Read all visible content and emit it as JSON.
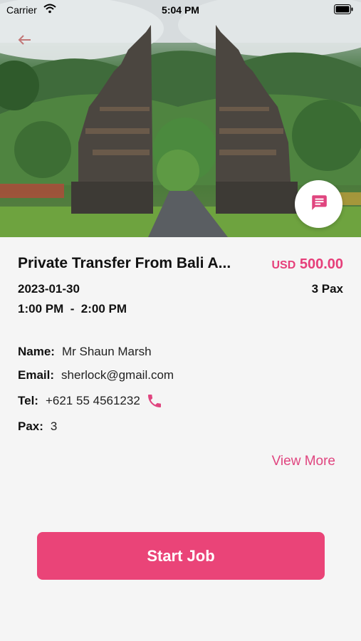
{
  "status_bar": {
    "carrier": "Carrier",
    "time": "5:04 PM"
  },
  "booking": {
    "title": "Private Transfer From Bali A...",
    "price_currency": "USD",
    "price_amount": "500.00",
    "date": "2023-01-30",
    "pax_summary": "3 Pax",
    "time_range": "1:00 PM  -  2:00 PM"
  },
  "customer": {
    "name_label": "Name:",
    "name_value": "Mr Shaun Marsh",
    "email_label": "Email:",
    "email_value": "sherlock@gmail.com",
    "tel_label": "Tel:",
    "tel_value": "+621 55 4561232",
    "pax_label": "Pax:",
    "pax_value": "3"
  },
  "actions": {
    "view_more": "View More",
    "start_job": "Start Job"
  },
  "colors": {
    "accent": "#ea4478",
    "price": "#e63f7a",
    "background": "#f5f5f5"
  },
  "icons": [
    "wifi-icon",
    "battery-icon",
    "back-arrow-icon",
    "chat-icon",
    "phone-icon"
  ]
}
